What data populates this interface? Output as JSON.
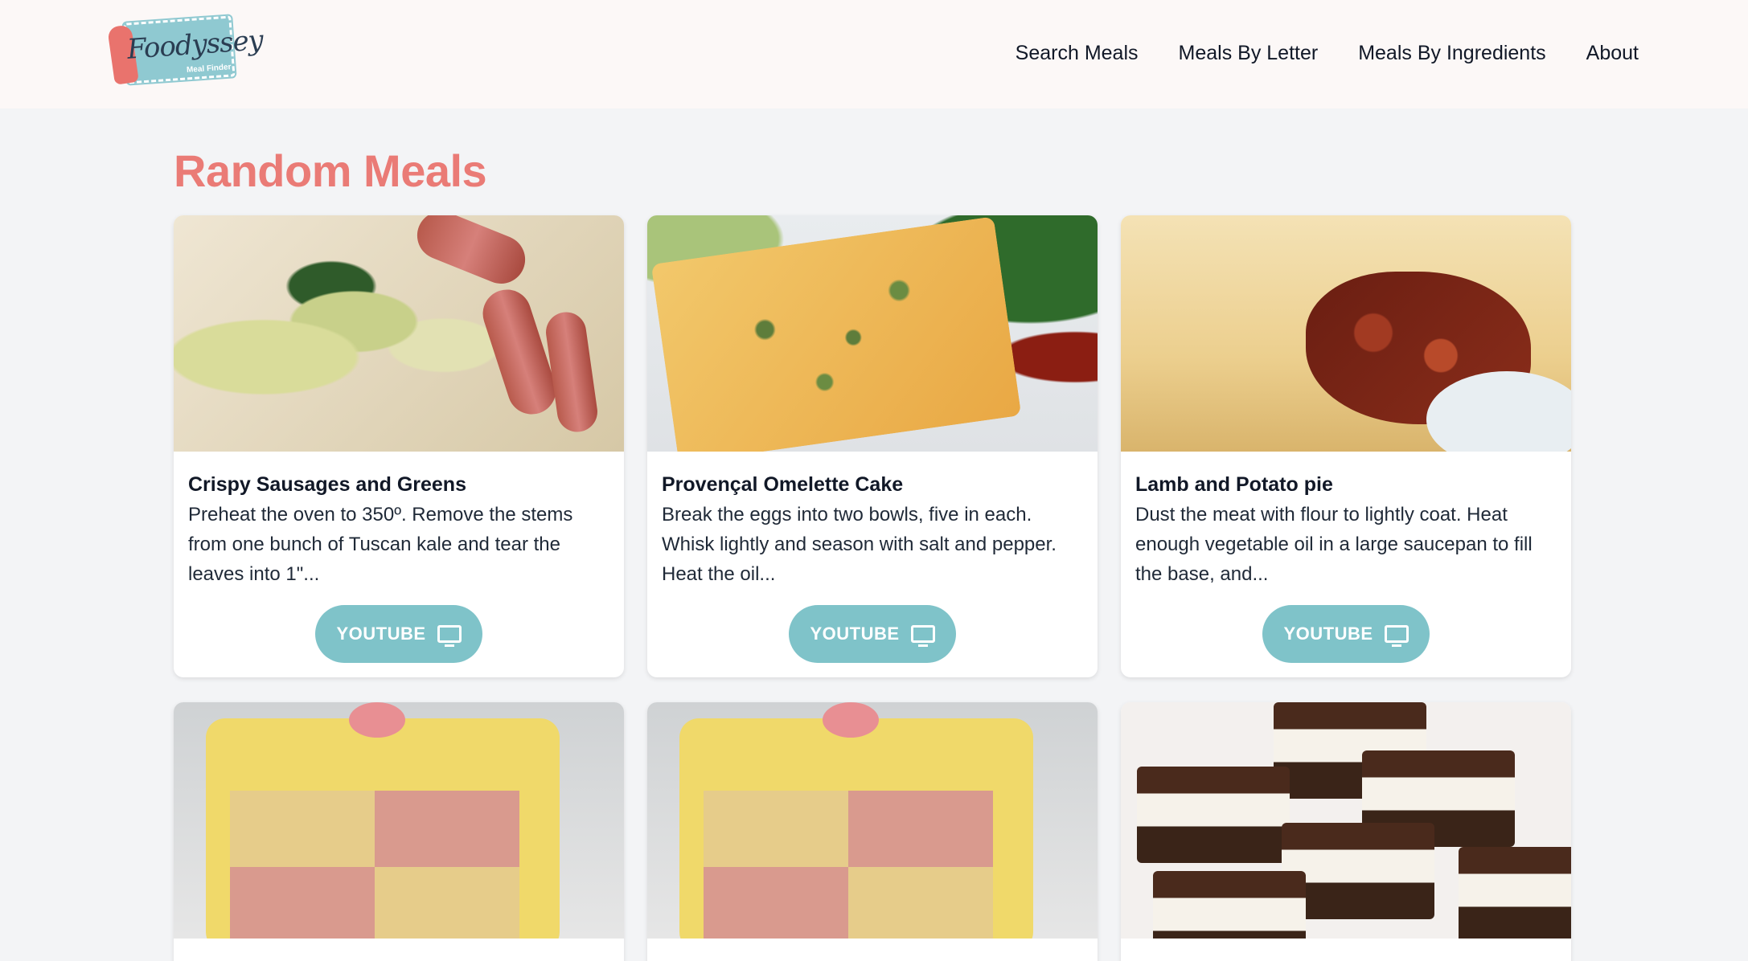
{
  "header": {
    "logo_text": "Foodyssey",
    "logo_subtitle": "Meal Finder",
    "nav": [
      {
        "label": "Search Meals"
      },
      {
        "label": "Meals By Letter"
      },
      {
        "label": "Meals By Ingredients"
      },
      {
        "label": "About"
      }
    ]
  },
  "page": {
    "title": "Random Meals"
  },
  "meals": [
    {
      "title": "Crispy Sausages and Greens",
      "description": "Preheat the oven to 350º. Remove the stems from one bunch of Tuscan kale and tear the leaves into 1\"...",
      "button_label": "YOUTUBE",
      "image": "sausages-greens-photo"
    },
    {
      "title": "Provençal Omelette Cake",
      "description": "Break the eggs into two bowls, five in each. Whisk lightly and season with salt and pepper. Heat the oil...",
      "button_label": "YOUTUBE",
      "image": "omelette-cake-photo"
    },
    {
      "title": "Lamb and Potato pie",
      "description": "Dust the meat with flour to lightly coat. Heat enough vegetable oil in a large saucepan to fill the base, and...",
      "button_label": "YOUTUBE",
      "image": "lamb-potato-pie-photo"
    },
    {
      "image": "battenberg-cake-photo"
    },
    {
      "image": "battenberg-cake-photo"
    },
    {
      "image": "nanaimo-bars-photo"
    }
  ],
  "icons": {
    "button_icon": "monitor-icon"
  },
  "colors": {
    "accent": "#ea7b76",
    "button": "#7fc3c9",
    "header_bg": "#fcf8f7",
    "page_bg": "#f3f4f6"
  }
}
